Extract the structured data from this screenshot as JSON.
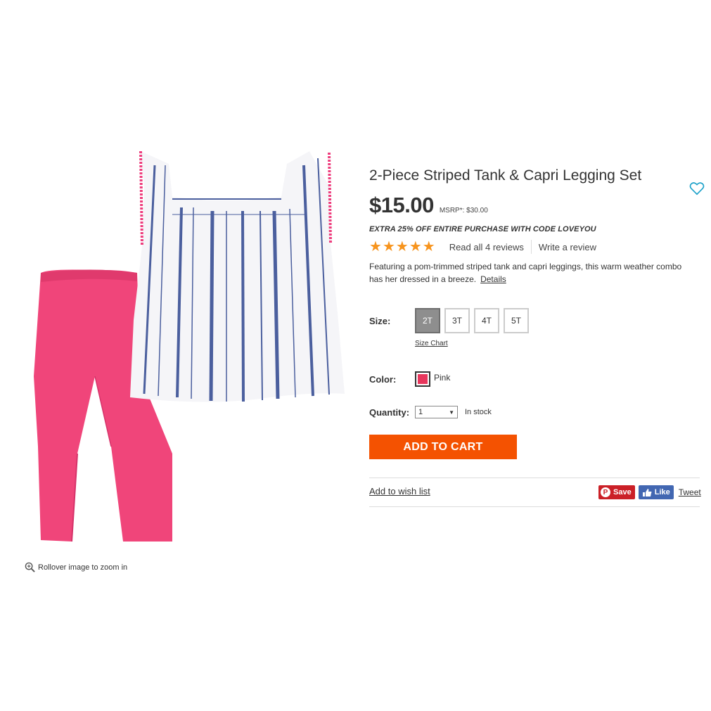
{
  "product": {
    "title": "2-Piece Striped Tank & Capri Legging Set",
    "price": "$15.00",
    "msrp": "MSRP*: $30.00",
    "promo": "EXTRA 25% OFF ENTIRE PURCHASE WITH CODE LOVEYOU",
    "rating": {
      "stars": 5,
      "read_reviews": "Read all 4 reviews",
      "write_review": "Write a review"
    },
    "description": "Featuring a pom-trimmed striped tank and capri leggings, this warm weather combo has her dressed in a breeze.",
    "details_link": "Details"
  },
  "size": {
    "label": "Size:",
    "options": [
      "2T",
      "3T",
      "4T",
      "5T"
    ],
    "selected": "2T",
    "chart_link": "Size Chart"
  },
  "color": {
    "label": "Color:",
    "value": "Pink",
    "swatch": "#e8365c"
  },
  "quantity": {
    "label": "Quantity:",
    "value": "1",
    "stock": "In stock"
  },
  "actions": {
    "add_to_cart": "ADD TO CART",
    "wish_list": "Add to wish list"
  },
  "social": {
    "pin": "Save",
    "like": "Like",
    "tweet": "Tweet"
  },
  "image": {
    "zoom_hint": "Rollover image to zoom in"
  },
  "colors": {
    "accent": "#f45201",
    "star": "#f7941d",
    "pinterest": "#cb2027",
    "facebook": "#4267b2",
    "heart": "#1ba1c9"
  },
  "icons": [
    "zoom-icon",
    "heart-icon",
    "star-icon",
    "pinterest-icon",
    "thumbs-up-icon",
    "dropdown-arrow-icon"
  ]
}
